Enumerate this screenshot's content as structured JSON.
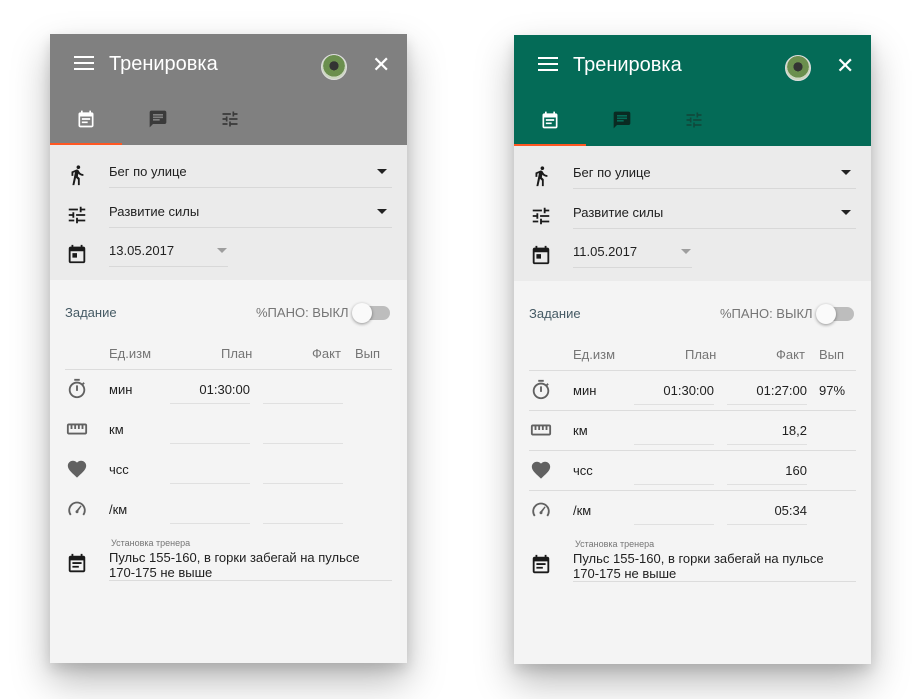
{
  "colors": {
    "accent": "#ff5722",
    "left_appbar": "#808080",
    "right_appbar": "#046b57"
  },
  "screens": [
    {
      "appbar": {
        "title": "Тренировка",
        "menu_icon": "menu-icon",
        "avatar": "avatar",
        "close_icon": "close-icon"
      },
      "tabs": [
        {
          "icon": "calendar-note-icon",
          "selected": true
        },
        {
          "icon": "chat-icon",
          "selected": false
        },
        {
          "icon": "sliders-icon",
          "selected": false
        }
      ],
      "activity": "Бег по улице",
      "goal": "Развитие силы",
      "date": "13.05.2017",
      "task_label": "Задание",
      "pano_label": "%ПАНО: ВЫКЛ",
      "pano_on": false,
      "headers": {
        "unit": "Ед.изм",
        "plan": "План",
        "fact": "Факт",
        "done": "Вып"
      },
      "rows": [
        {
          "icon": "stopwatch-icon",
          "unit": "мин",
          "plan": "01:30:00",
          "fact": "",
          "done": ""
        },
        {
          "icon": "ruler-icon",
          "unit": "км",
          "plan": "",
          "fact": "",
          "done": ""
        },
        {
          "icon": "heart-icon",
          "unit": "чсс",
          "plan": "",
          "fact": "",
          "done": ""
        },
        {
          "icon": "speedometer-icon",
          "unit": "/км",
          "plan": "",
          "fact": "",
          "done": ""
        }
      ],
      "coach_caption": "Установка тренера",
      "coach_text": "Пульс 155-160, в горки забегай на пульсе 170-175 не выше"
    },
    {
      "appbar": {
        "title": "Тренировка",
        "menu_icon": "menu-icon",
        "avatar": "avatar",
        "close_icon": "close-icon"
      },
      "tabs": [
        {
          "icon": "calendar-note-icon",
          "selected": true
        },
        {
          "icon": "chat-icon",
          "selected": false
        },
        {
          "icon": "sliders-icon",
          "selected": false
        }
      ],
      "activity": "Бег по улице",
      "goal": "Развитие силы",
      "date": "11.05.2017",
      "task_label": "Задание",
      "pano_label": "%ПАНО: ВЫКЛ",
      "pano_on": false,
      "headers": {
        "unit": "Ед.изм",
        "plan": "План",
        "fact": "Факт",
        "done": "Вып"
      },
      "rows": [
        {
          "icon": "stopwatch-icon",
          "unit": "мин",
          "plan": "01:30:00",
          "fact": "01:27:00",
          "done": "97%"
        },
        {
          "icon": "ruler-icon",
          "unit": "км",
          "plan": "",
          "fact": "18,2",
          "done": ""
        },
        {
          "icon": "heart-icon",
          "unit": "чсс",
          "plan": "",
          "fact": "160",
          "done": ""
        },
        {
          "icon": "speedometer-icon",
          "unit": "/км",
          "plan": "",
          "fact": "05:34",
          "done": ""
        }
      ],
      "coach_caption": "Установка тренера",
      "coach_text": "Пульс 155-160, в горки забегай на пульсе 170-175 не выше"
    }
  ]
}
